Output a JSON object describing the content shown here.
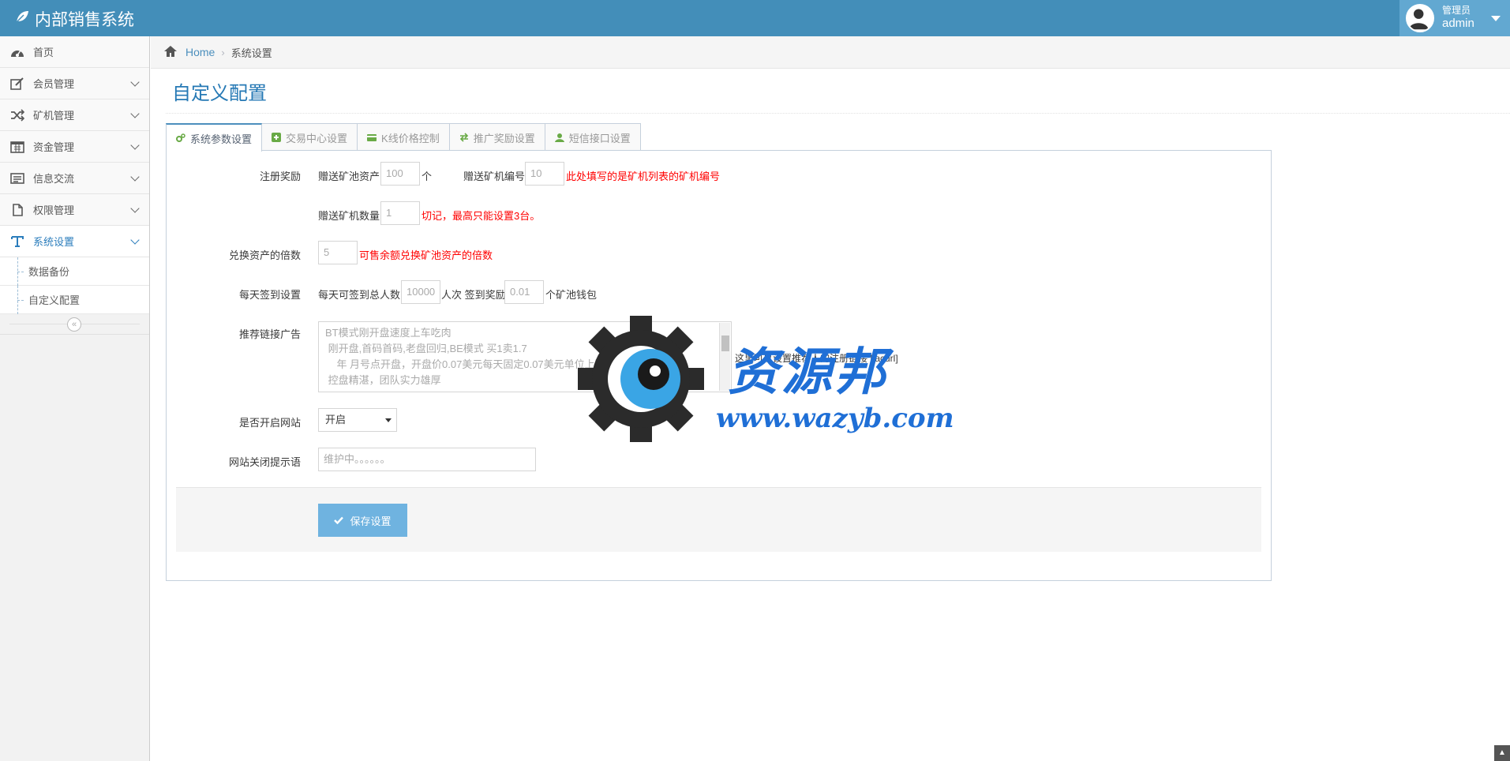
{
  "app": {
    "title": "内部销售系统"
  },
  "user": {
    "role": "管理员",
    "name": "admin"
  },
  "sidebar": {
    "items": [
      {
        "label": "首页",
        "icon": "dashboard-icon"
      },
      {
        "label": "会员管理",
        "icon": "edit-icon"
      },
      {
        "label": "矿机管理",
        "icon": "random-icon"
      },
      {
        "label": "资金管理",
        "icon": "calendar-icon"
      },
      {
        "label": "信息交流",
        "icon": "list-icon"
      },
      {
        "label": "权限管理",
        "icon": "file-icon"
      },
      {
        "label": "系统设置",
        "icon": "text-icon"
      }
    ],
    "subitems": [
      {
        "label": "数据备份"
      },
      {
        "label": "自定义配置"
      }
    ]
  },
  "breadcrumb": {
    "home": "Home",
    "current": "系统设置"
  },
  "page": {
    "title": "自定义配置"
  },
  "tabs": [
    {
      "label": "系统参数设置",
      "icon": "cogs-icon",
      "color": "#69aa46"
    },
    {
      "label": "交易中心设置",
      "icon": "plus-square-icon",
      "color": "#69aa46"
    },
    {
      "label": "K线价格控制",
      "icon": "credit-card-icon",
      "color": "#69aa46"
    },
    {
      "label": "推广奖励设置",
      "icon": "exchange-icon",
      "color": "#69aa46"
    },
    {
      "label": "短信接口设置",
      "icon": "user-icon",
      "color": "#69aa46"
    }
  ],
  "form": {
    "register_reward": {
      "label": "注册奖励",
      "gift_asset_label": "赠送矿池资产",
      "gift_asset_value": "100",
      "gift_asset_unit": "个",
      "machine_no_label": "赠送矿机编号",
      "machine_no_value": "10",
      "machine_no_note": "此处填写的是矿机列表的矿机编号",
      "machine_qty_label": "赠送矿机数量",
      "machine_qty_value": "1",
      "machine_qty_note": "切记，最高只能设置3台。"
    },
    "exchange": {
      "label": "兑换资产的倍数",
      "value": "5",
      "note": "可售余额兑换矿池资产的倍数"
    },
    "signin": {
      "label": "每天签到设置",
      "count_label": "每天可签到总人数",
      "count_value": "10000",
      "count_unit": "人次 签到奖励",
      "reward_value": "0.01",
      "reward_unit": "个矿池钱包"
    },
    "ad": {
      "label": "推荐链接广告",
      "lines": [
        "BT模式刚开盘速度上车吃肉",
        " 刚开盘,首码首码,老盘回归,BE模式 买1卖1.7",
        "    年 月号点开盘，开盘价0.07美元每天固定0.07美元单位上涨",
        " 控盘精湛，团队实力雄厚"
      ],
      "hint": "这里可以设置推荐人的注册链接 [iacurl]"
    },
    "site_open": {
      "label": "是否开启网站",
      "value": "开启"
    },
    "close_msg": {
      "label": "网站关闭提示语",
      "placeholder": "维护中。。。。。。"
    },
    "save_label": "保存设置"
  },
  "watermark": {
    "text": "资源邦",
    "url": "www.wazyb.com"
  }
}
